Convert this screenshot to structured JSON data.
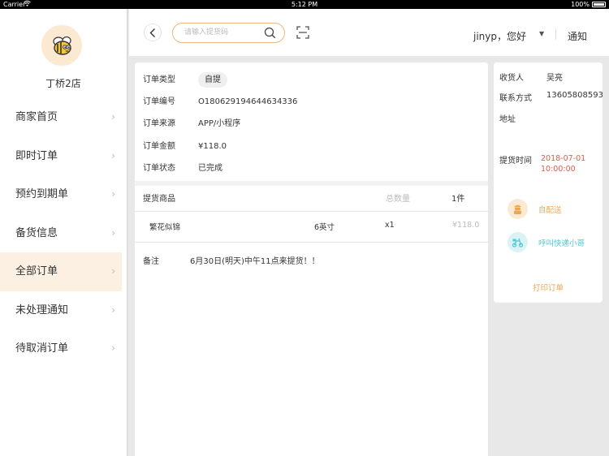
{
  "status_bar": {
    "carrier": "Carrier",
    "time": "5:12 PM",
    "battery": "100%"
  },
  "sidebar": {
    "store_name": "丁桥2店",
    "items": [
      {
        "label": "商家首页",
        "active": false
      },
      {
        "label": "即时订单",
        "active": false
      },
      {
        "label": "预约到期单",
        "active": false
      },
      {
        "label": "备货信息",
        "active": false
      },
      {
        "label": "全部订单",
        "active": true
      },
      {
        "label": "未处理通知",
        "active": false
      },
      {
        "label": "待取消订单",
        "active": false
      }
    ]
  },
  "header": {
    "search_placeholder": "请输入提货码",
    "user": "jinyp，您好",
    "notice": "通知"
  },
  "order": {
    "type_label": "订单类型",
    "type_value": "自提",
    "number_label": "订单编号",
    "number_value": "O180629194644634336",
    "source_label": "订单来源",
    "source_value": "APP/小程序",
    "amount_label": "订单金额",
    "amount_value": "¥118.0",
    "status_label": "订单状态",
    "status_value": "已完成"
  },
  "goods": {
    "header_label": "提货商品",
    "qty_label": "总数量",
    "qty_value": "1件",
    "items": [
      {
        "name": "繁花似锦",
        "spec": "6英寸",
        "count": "x1",
        "price": "¥118.0"
      }
    ],
    "remark_label": "备注",
    "remark_value": "6月30日(明天)中午11点来提货！！"
  },
  "recipient": {
    "name_label": "收货人",
    "name_value": "吴亮",
    "contact_label": "联系方式",
    "contact_value": "13605808593",
    "address_label": "地址",
    "pickup_time_label": "提货时间",
    "pickup_date": "2018-07-01",
    "pickup_hour": "10:00:00",
    "self_delivery": "自配送",
    "courier": "呼叫快递小哥",
    "print": "打印订单"
  },
  "colors": {
    "accent_orange": "#f0a64e",
    "active_bg": "#fbf0e2",
    "time_red": "#e35a4f",
    "courier_teal": "#4dc8d4"
  }
}
